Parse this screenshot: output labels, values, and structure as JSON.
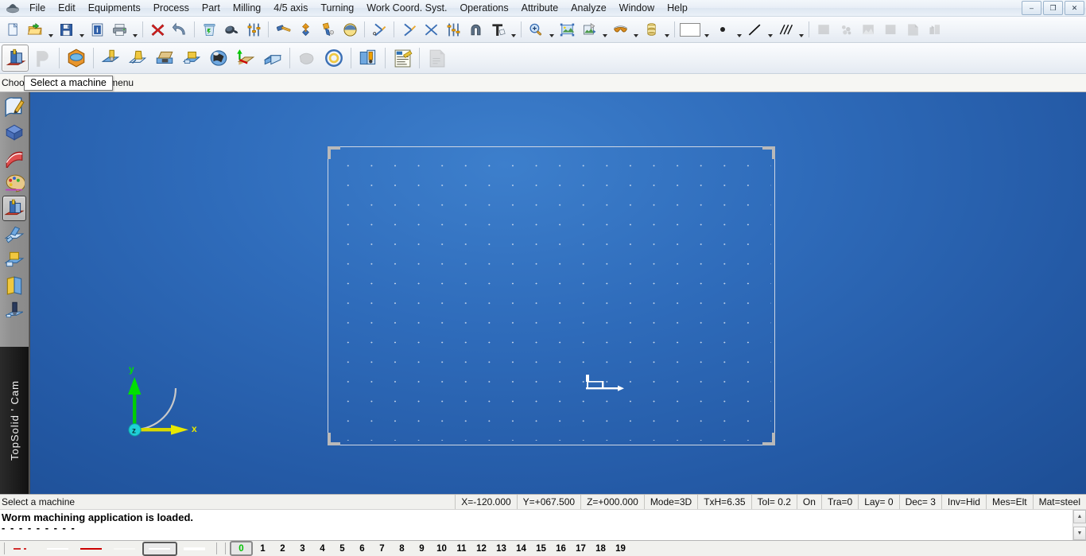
{
  "app": {
    "title": "TopSolid'Cam",
    "brand": "TopSolid ' Cam",
    "app_icon": "application-icon"
  },
  "window_controls": [
    {
      "name": "minimize-button",
      "glyph": "–"
    },
    {
      "name": "restore-button",
      "glyph": "❐"
    },
    {
      "name": "close-button",
      "glyph": "✕"
    }
  ],
  "menubar": {
    "items": [
      {
        "label": "File",
        "name": "menu-file"
      },
      {
        "label": "Edit",
        "name": "menu-edit"
      },
      {
        "label": "Equipments",
        "name": "menu-equipments"
      },
      {
        "label": "Process",
        "name": "menu-process"
      },
      {
        "label": "Part",
        "name": "menu-part"
      },
      {
        "label": "Milling",
        "name": "menu-milling"
      },
      {
        "label": "4/5 axis",
        "name": "menu-4-5-axis"
      },
      {
        "label": "Turning",
        "name": "menu-turning"
      },
      {
        "label": "Work Coord. Syst.",
        "name": "menu-work-coord-syst"
      },
      {
        "label": "Operations",
        "name": "menu-operations"
      },
      {
        "label": "Attribute",
        "name": "menu-attribute"
      },
      {
        "label": "Analyze",
        "name": "menu-analyze"
      },
      {
        "label": "Window",
        "name": "menu-window"
      },
      {
        "label": "Help",
        "name": "menu-help"
      }
    ]
  },
  "toolbar_main": {
    "icons": [
      {
        "name": "new-document-icon",
        "type": "new"
      },
      {
        "name": "open-folder-icon",
        "type": "open"
      },
      {
        "name": "open-dropdown-caret",
        "type": "caret"
      },
      {
        "name": "save-icon",
        "type": "save"
      },
      {
        "name": "save-dropdown-caret",
        "type": "caret"
      },
      {
        "name": "document-info-icon",
        "type": "info"
      },
      {
        "name": "print-icon",
        "type": "print"
      },
      {
        "name": "print-dropdown-caret",
        "type": "caret"
      },
      {
        "name": "separator",
        "type": "sep"
      },
      {
        "name": "delete-icon",
        "type": "delete"
      },
      {
        "name": "undo-icon",
        "type": "undo"
      },
      {
        "name": "separator",
        "type": "sep"
      },
      {
        "name": "recycle-bin-icon",
        "type": "bin"
      },
      {
        "name": "polish-tool-icon",
        "type": "polish"
      },
      {
        "name": "parameters-sliders-icon",
        "type": "sliders"
      },
      {
        "name": "separator",
        "type": "sep"
      },
      {
        "name": "hammer-icon",
        "type": "hammer"
      },
      {
        "name": "clamp-icon",
        "type": "clamp"
      },
      {
        "name": "drill-tool-icon",
        "type": "drilltool"
      },
      {
        "name": "sphere-tool-icon",
        "type": "sphere"
      },
      {
        "name": "separator",
        "type": "sep"
      },
      {
        "name": "snap-point-icon",
        "type": "snap1"
      },
      {
        "name": "separator",
        "type": "sep"
      },
      {
        "name": "snap-element-icon",
        "type": "snap2"
      },
      {
        "name": "snap-intersection-icon",
        "type": "snapx"
      },
      {
        "name": "settings-sliders-icon",
        "type": "sliders2"
      },
      {
        "name": "magnet-icon",
        "type": "magnet"
      },
      {
        "name": "text-tool-icon",
        "type": "text"
      },
      {
        "name": "text-dropdown-caret",
        "type": "caret"
      },
      {
        "name": "separator",
        "type": "sep"
      },
      {
        "name": "zoom-icon",
        "type": "zoom"
      },
      {
        "name": "zoom-dropdown-caret",
        "type": "caret"
      },
      {
        "name": "fit-view-icon",
        "type": "fit"
      },
      {
        "name": "view-layout-icon",
        "type": "viewlayout"
      },
      {
        "name": "view-layout-dropdown-caret",
        "type": "caret"
      },
      {
        "name": "glasses-view-icon",
        "type": "glasses"
      },
      {
        "name": "glasses-dropdown-caret",
        "type": "caret"
      },
      {
        "name": "shading-icon",
        "type": "shading"
      },
      {
        "name": "shading-dropdown-caret",
        "type": "caret"
      },
      {
        "name": "separator",
        "type": "sep"
      },
      {
        "name": "color-swatch",
        "type": "swatch"
      },
      {
        "name": "color-dropdown-caret",
        "type": "caret"
      },
      {
        "name": "point-style-icon",
        "type": "dot"
      },
      {
        "name": "point-style-dropdown-caret",
        "type": "caret"
      },
      {
        "name": "line-style-icon",
        "type": "line"
      },
      {
        "name": "line-style-dropdown-caret",
        "type": "caret"
      },
      {
        "name": "hatch-style-icon",
        "type": "hatch"
      },
      {
        "name": "hatch-style-dropdown-caret",
        "type": "caret"
      },
      {
        "name": "separator",
        "type": "sep"
      },
      {
        "name": "layer-block-icon",
        "type": "gray1",
        "disabled": true
      },
      {
        "name": "cloud-points-icon",
        "type": "gray2",
        "disabled": true
      },
      {
        "name": "terrain-icon",
        "type": "gray3",
        "disabled": true
      },
      {
        "name": "solid-block-icon",
        "type": "gray4",
        "disabled": true
      },
      {
        "name": "sheet-icon",
        "type": "gray5",
        "disabled": true
      },
      {
        "name": "assembly-icon",
        "type": "gray6",
        "disabled": true
      }
    ]
  },
  "toolbar_cam": {
    "icons": [
      {
        "name": "select-machine-icon",
        "type": "machine",
        "pressed": true,
        "tooltip": "Select a machine"
      },
      {
        "name": "post-processor-icon",
        "type": "pglyph",
        "disabled": true
      },
      {
        "name": "separator",
        "type": "sep"
      },
      {
        "name": "stock-icon",
        "type": "stock"
      },
      {
        "name": "separator",
        "type": "sep"
      },
      {
        "name": "tool-holder-icon",
        "type": "cam1"
      },
      {
        "name": "milling-tool-icon",
        "type": "cam2"
      },
      {
        "name": "vise-icon",
        "type": "cam3"
      },
      {
        "name": "clamp-part-icon",
        "type": "cam4"
      },
      {
        "name": "tool-magazine-icon",
        "type": "cam5"
      },
      {
        "name": "work-coordinate-icon",
        "type": "cam6"
      },
      {
        "name": "part-block-icon",
        "type": "cam7"
      },
      {
        "name": "separator",
        "type": "sep"
      },
      {
        "name": "pocket-icon",
        "type": "cam8",
        "disabled": true
      },
      {
        "name": "circular-pocket-icon",
        "type": "cam9"
      },
      {
        "name": "separator",
        "type": "sep"
      },
      {
        "name": "simulation-icon",
        "type": "cam10"
      },
      {
        "name": "separator",
        "type": "sep"
      },
      {
        "name": "nc-program-icon",
        "type": "cam11"
      },
      {
        "name": "separator",
        "type": "sep"
      },
      {
        "name": "nc-document-icon",
        "type": "cam12",
        "disabled": true
      }
    ]
  },
  "hint": {
    "text": "Choose a machine in the menu",
    "tooltip": "Select a machine"
  },
  "sidebar": {
    "items": [
      {
        "name": "sidebar-item-sketch",
        "type": "sk-sketch"
      },
      {
        "name": "sidebar-item-shape",
        "type": "sk-shape"
      },
      {
        "name": "sidebar-item-surface",
        "type": "sk-surface"
      },
      {
        "name": "sidebar-item-attribute",
        "type": "sk-palette"
      },
      {
        "name": "sidebar-item-machine",
        "type": "sk-machine",
        "selected": true
      },
      {
        "name": "sidebar-item-operations",
        "type": "sk-ops"
      },
      {
        "name": "sidebar-item-tooling",
        "type": "sk-tooling"
      },
      {
        "name": "sidebar-item-documents",
        "type": "sk-docs"
      },
      {
        "name": "sidebar-item-simulation",
        "type": "sk-sim"
      }
    ]
  },
  "viewport": {
    "axis_gizmo": {
      "x_label": "x",
      "y_label": "y",
      "z_label": "z",
      "x_color": "#e8e800",
      "y_color": "#00e000",
      "z_color": "#1fd0d8"
    },
    "background_color": "#2f6cbb",
    "grid_color": "#dfe7f2"
  },
  "statusbar": {
    "message": "Select a machine",
    "cells": [
      {
        "name": "status-x",
        "label": "X=-120.000"
      },
      {
        "name": "status-y",
        "label": "Y=+067.500"
      },
      {
        "name": "status-z",
        "label": "Z=+000.000"
      },
      {
        "name": "status-mode",
        "label": "Mode=3D"
      },
      {
        "name": "status-txh",
        "label": "TxH=6.35"
      },
      {
        "name": "status-tol",
        "label": "Tol=  0.2"
      },
      {
        "name": "status-on",
        "label": "On"
      },
      {
        "name": "status-tra",
        "label": "Tra=0"
      },
      {
        "name": "status-lay",
        "label": "Lay=  0"
      },
      {
        "name": "status-dec",
        "label": "Dec= 3"
      },
      {
        "name": "status-inv",
        "label": "Inv=Hid"
      },
      {
        "name": "status-mes",
        "label": "Mes=Elt"
      },
      {
        "name": "status-mat",
        "label": "Mat=steel"
      }
    ]
  },
  "console": {
    "line1": "Worm machining application is loaded.",
    "line2": "- - - - - - - - -",
    "scroll_up": "▲",
    "scroll_down": "▼"
  },
  "bottombar": {
    "line_styles": [
      {
        "name": "line-style-dashdot",
        "pattern": "dashdot",
        "color": "#cc0000"
      },
      {
        "name": "line-style-solid-white",
        "pattern": "solid",
        "color": "#ffffff"
      },
      {
        "name": "line-style-solid-red",
        "pattern": "solid",
        "color": "#cc0000"
      },
      {
        "name": "line-style-thin-white",
        "pattern": "thin",
        "color": "#ffffff"
      },
      {
        "name": "line-style-selected",
        "pattern": "solid",
        "color": "#ffffff",
        "selected": true
      },
      {
        "name": "line-style-thick-white",
        "pattern": "thick",
        "color": "#ffffff"
      }
    ],
    "layers": [
      "0",
      "1",
      "2",
      "3",
      "4",
      "5",
      "6",
      "7",
      "8",
      "9",
      "10",
      "11",
      "12",
      "13",
      "14",
      "15",
      "16",
      "17",
      "18",
      "19"
    ],
    "active_layer": "0",
    "active_layer_color": "#00c000"
  }
}
